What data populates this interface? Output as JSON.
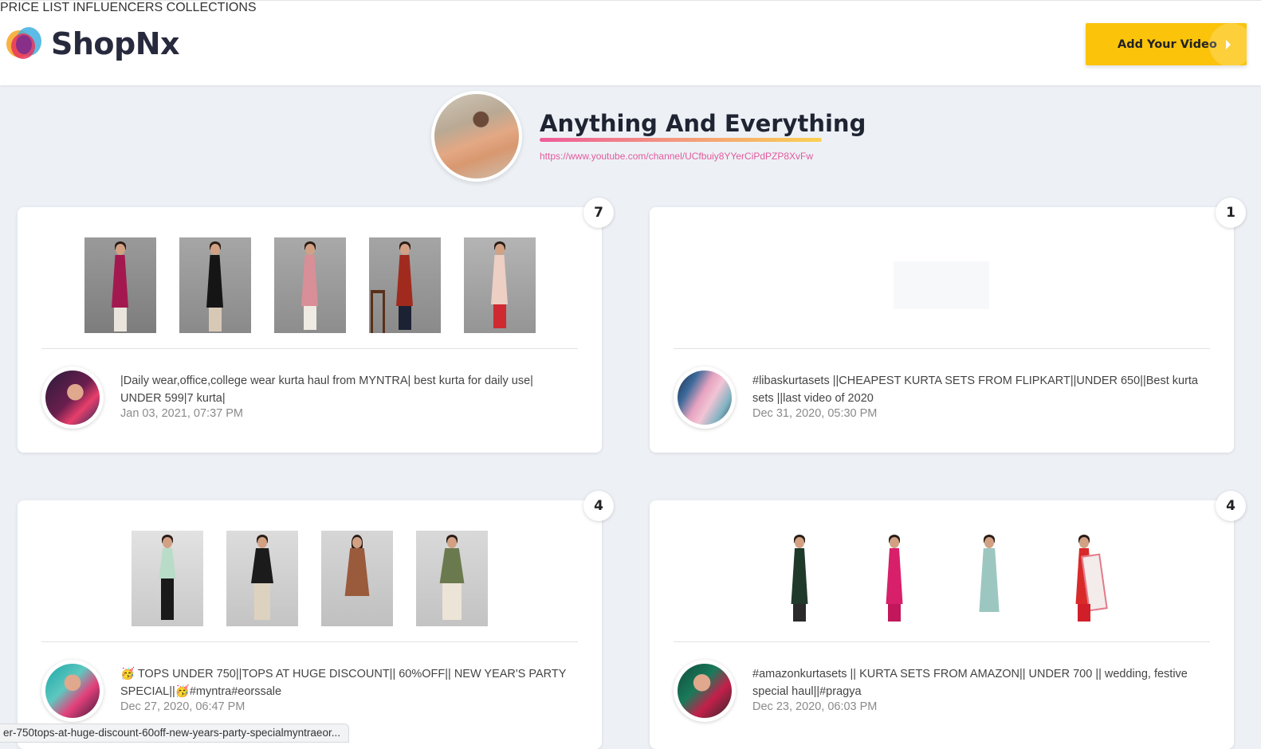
{
  "header": {
    "brand": "ShopNx",
    "nav": [
      "PRICE LIST",
      "INFLUENCERS",
      "COLLECTIONS"
    ],
    "cta_label": "Add Your Video"
  },
  "channel": {
    "title": "Anything And Everything",
    "url": "https://www.youtube.com/channel/UCfbuiy8YYerCiPdPZP8XvFw"
  },
  "videos": [
    {
      "count": "7",
      "title": "|Daily wear,office,college wear kurta haul from MYNTRA| best kurta for daily use| UNDER 599|7 kurta|",
      "date": "Jan 03, 2021, 07:37 PM"
    },
    {
      "count": "1",
      "title": "#libaskurtasets ||CHEAPEST KURTA SETS FROM FLIPKART||UNDER 650||Best kurta sets ||last video of 2020",
      "date": "Dec 31, 2020, 05:30 PM"
    },
    {
      "count": "4",
      "title": "🥳 TOPS UNDER 750||TOPS AT HUGE DISCOUNT|| 60%OFF|| NEW YEAR'S PARTY SPECIAL||🥳#myntra#eorssale",
      "date": "Dec 27, 2020, 06:47 PM"
    },
    {
      "count": "4",
      "title": "#amazonkurtasets || KURTA SETS FROM AMAZON|| UNDER 700 || wedding, festive special haul||#pragya",
      "date": "Dec 23, 2020, 06:03 PM"
    }
  ],
  "status_bar": "er-750tops-at-huge-discount-60off-new-years-party-specialmyntraeor...",
  "colors": {
    "accent": "#fcc30b",
    "link": "#e25a9b",
    "background": "#edf1f6"
  }
}
